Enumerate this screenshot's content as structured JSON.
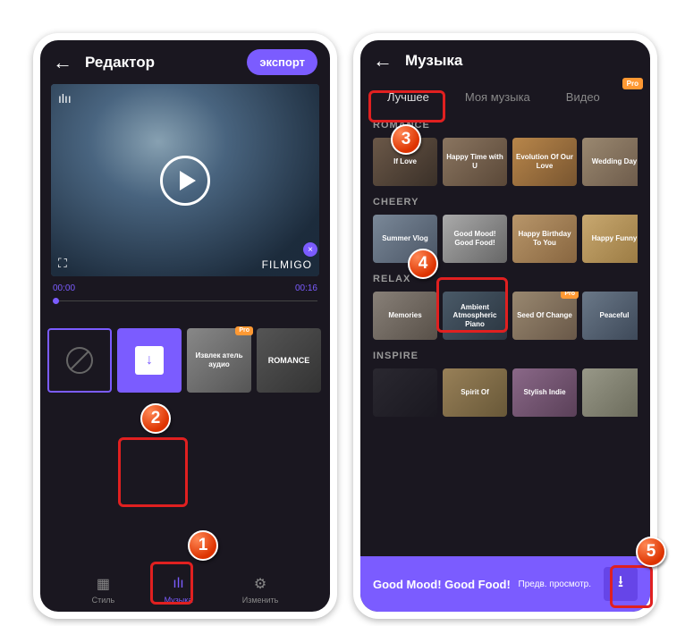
{
  "left": {
    "title": "Редактор",
    "export": "экспорт",
    "watermark": "FILMIGO",
    "timeStart": "00:00",
    "timeEnd": "00:16",
    "thumbs": {
      "extractor": "Извлек атель аудио",
      "romance": "ROMANCE",
      "proTag": "Pro"
    },
    "nav": {
      "style": "Стиль",
      "music": "Музыка",
      "edit": "Изменить"
    }
  },
  "right": {
    "title": "Музыка",
    "tabs": {
      "best": "Лучшее",
      "myMusic": "Моя музыка",
      "video": "Видео"
    },
    "pro": "Pro",
    "categories": {
      "romance": {
        "title": "ROMANCE",
        "tracks": [
          "If Love",
          "Happy Time with U",
          "Evolution Of Our Love",
          "Wedding Day"
        ]
      },
      "cheery": {
        "title": "CHEERY",
        "tracks": [
          "Summer Vlog",
          "Good Mood! Good Food!",
          "Happy Birthday To You",
          "Happy Funny"
        ]
      },
      "relax": {
        "title": "RELAX",
        "tracks": [
          "Memories",
          "Ambient Atmospheric Piano",
          "Seed Of Change",
          "Peaceful"
        ]
      },
      "inspire": {
        "title": "INSPIRE",
        "tracks": [
          "",
          "Spirit Of",
          "Stylish Indie",
          ""
        ]
      }
    },
    "nowPlaying": {
      "title": "Good Mood! Good Food!",
      "preview": "Предв. просмотр."
    }
  },
  "callouts": [
    "1",
    "2",
    "3",
    "4",
    "5"
  ]
}
